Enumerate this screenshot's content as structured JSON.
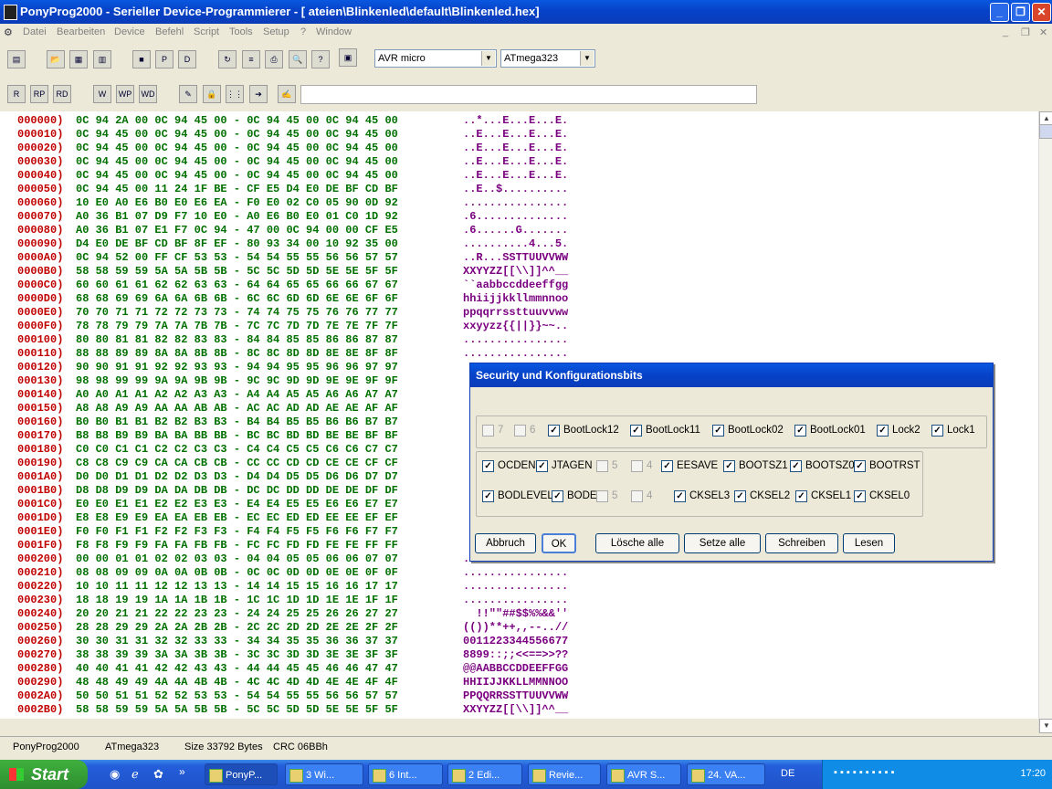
{
  "window": {
    "title": "PonyProg2000 - Serieller Device-Programmierer - [ ateien\\Blinkenled\\default\\Blinkenled.hex]",
    "minimize": "_",
    "maximize": "❐",
    "close": "✕"
  },
  "menu": [
    "Datei",
    "Bearbeiten",
    "Device",
    "Befehl",
    "Script",
    "Tools",
    "Setup",
    "?",
    "Window"
  ],
  "toolbar": {
    "device_family": "AVR micro",
    "device_model": "ATmega323",
    "status_text": ""
  },
  "hex_rows": [
    {
      "addr": "000000)",
      "hex": "0C 94 2A 00 0C 94 45 00 - 0C 94 45 00 0C 94 45 00",
      "ascii": "..*...E...E...E."
    },
    {
      "addr": "000010)",
      "hex": "0C 94 45 00 0C 94 45 00 - 0C 94 45 00 0C 94 45 00",
      "ascii": "..E...E...E...E."
    },
    {
      "addr": "000020)",
      "hex": "0C 94 45 00 0C 94 45 00 - 0C 94 45 00 0C 94 45 00",
      "ascii": "..E...E...E...E."
    },
    {
      "addr": "000030)",
      "hex": "0C 94 45 00 0C 94 45 00 - 0C 94 45 00 0C 94 45 00",
      "ascii": "..E...E...E...E."
    },
    {
      "addr": "000040)",
      "hex": "0C 94 45 00 0C 94 45 00 - 0C 94 45 00 0C 94 45 00",
      "ascii": "..E...E...E...E."
    },
    {
      "addr": "000050)",
      "hex": "0C 94 45 00 11 24 1F BE - CF E5 D4 E0 DE BF CD BF",
      "ascii": "..E..$.........."
    },
    {
      "addr": "000060)",
      "hex": "10 E0 A0 E6 B0 E0 E6 EA - F0 E0 02 C0 05 90 0D 92",
      "ascii": "................"
    },
    {
      "addr": "000070)",
      "hex": "A0 36 B1 07 D9 F7 10 E0 - A0 E6 B0 E0 01 C0 1D 92",
      "ascii": ".6.............."
    },
    {
      "addr": "000080)",
      "hex": "A0 36 B1 07 E1 F7 0C 94 - 47 00 0C 94 00 00 CF E5",
      "ascii": ".6......G......."
    },
    {
      "addr": "000090)",
      "hex": "D4 E0 DE BF CD BF 8F EF - 80 93 34 00 10 92 35 00",
      "ascii": "..........4...5."
    },
    {
      "addr": "0000A0)",
      "hex": "0C 94 52 00 FF CF 53 53 - 54 54 55 55 56 56 57 57",
      "ascii": "..R...SSTTUUVVWW"
    },
    {
      "addr": "0000B0)",
      "hex": "58 58 59 59 5A 5A 5B 5B - 5C 5C 5D 5D 5E 5E 5F 5F",
      "ascii": "XXYYZZ[[\\\\]]^^__"
    },
    {
      "addr": "0000C0)",
      "hex": "60 60 61 61 62 62 63 63 - 64 64 65 65 66 66 67 67",
      "ascii": "``aabbccddeeffgg"
    },
    {
      "addr": "0000D0)",
      "hex": "68 68 69 69 6A 6A 6B 6B - 6C 6C 6D 6D 6E 6E 6F 6F",
      "ascii": "hhiijjkkllmmnnoo"
    },
    {
      "addr": "0000E0)",
      "hex": "70 70 71 71 72 72 73 73 - 74 74 75 75 76 76 77 77",
      "ascii": "ppqqrrssttuuvvww"
    },
    {
      "addr": "0000F0)",
      "hex": "78 78 79 79 7A 7A 7B 7B - 7C 7C 7D 7D 7E 7E 7F 7F",
      "ascii": "xxyyzz{{||}}~~.."
    },
    {
      "addr": "000100)",
      "hex": "80 80 81 81 82 82 83 83 - 84 84 85 85 86 86 87 87",
      "ascii": "................"
    },
    {
      "addr": "000110)",
      "hex": "88 88 89 89 8A 8A 8B 8B - 8C 8C 8D 8D 8E 8E 8F 8F",
      "ascii": "................"
    },
    {
      "addr": "000120)",
      "hex": "90 90 91 91 92 92 93 93 - 94 94 95 95 96 96 97 97",
      "ascii": ""
    },
    {
      "addr": "000130)",
      "hex": "98 98 99 99 9A 9A 9B 9B - 9C 9C 9D 9D 9E 9E 9F 9F",
      "ascii": ""
    },
    {
      "addr": "000140)",
      "hex": "A0 A0 A1 A1 A2 A2 A3 A3 - A4 A4 A5 A5 A6 A6 A7 A7",
      "ascii": ""
    },
    {
      "addr": "000150)",
      "hex": "A8 A8 A9 A9 AA AA AB AB - AC AC AD AD AE AE AF AF",
      "ascii": ""
    },
    {
      "addr": "000160)",
      "hex": "B0 B0 B1 B1 B2 B2 B3 B3 - B4 B4 B5 B5 B6 B6 B7 B7",
      "ascii": ""
    },
    {
      "addr": "000170)",
      "hex": "B8 B8 B9 B9 BA BA BB BB - BC BC BD BD BE BE BF BF",
      "ascii": ""
    },
    {
      "addr": "000180)",
      "hex": "C0 C0 C1 C1 C2 C2 C3 C3 - C4 C4 C5 C5 C6 C6 C7 C7",
      "ascii": ""
    },
    {
      "addr": "000190)",
      "hex": "C8 C8 C9 C9 CA CA CB CB - CC CC CD CD CE CE CF CF",
      "ascii": ""
    },
    {
      "addr": "0001A0)",
      "hex": "D0 D0 D1 D1 D2 D2 D3 D3 - D4 D4 D5 D5 D6 D6 D7 D7",
      "ascii": ""
    },
    {
      "addr": "0001B0)",
      "hex": "D8 D8 D9 D9 DA DA DB DB - DC DC DD DD DE DE DF DF",
      "ascii": ""
    },
    {
      "addr": "0001C0)",
      "hex": "E0 E0 E1 E1 E2 E2 E3 E3 - E4 E4 E5 E5 E6 E6 E7 E7",
      "ascii": ""
    },
    {
      "addr": "0001D0)",
      "hex": "E8 E8 E9 E9 EA EA EB EB - EC EC ED ED EE EE EF EF",
      "ascii": ""
    },
    {
      "addr": "0001E0)",
      "hex": "F0 F0 F1 F1 F2 F2 F3 F3 - F4 F4 F5 F5 F6 F6 F7 F7",
      "ascii": ""
    },
    {
      "addr": "0001F0)",
      "hex": "F8 F8 F9 F9 FA FA FB FB - FC FC FD FD FE FE FF FF",
      "ascii": ""
    },
    {
      "addr": "000200)",
      "hex": "00 00 01 01 02 02 03 03 - 04 04 05 05 06 06 07 07",
      "ascii": "................"
    },
    {
      "addr": "000210)",
      "hex": "08 08 09 09 0A 0A 0B 0B - 0C 0C 0D 0D 0E 0E 0F 0F",
      "ascii": "................"
    },
    {
      "addr": "000220)",
      "hex": "10 10 11 11 12 12 13 13 - 14 14 15 15 16 16 17 17",
      "ascii": "................"
    },
    {
      "addr": "000230)",
      "hex": "18 18 19 19 1A 1A 1B 1B - 1C 1C 1D 1D 1E 1E 1F 1F",
      "ascii": "................"
    },
    {
      "addr": "000240)",
      "hex": "20 20 21 21 22 22 23 23 - 24 24 25 25 26 26 27 27",
      "ascii": "  !!\"\"##$$%%&&''"
    },
    {
      "addr": "000250)",
      "hex": "28 28 29 29 2A 2A 2B 2B - 2C 2C 2D 2D 2E 2E 2F 2F",
      "ascii": "(())**++,,--..//"
    },
    {
      "addr": "000260)",
      "hex": "30 30 31 31 32 32 33 33 - 34 34 35 35 36 36 37 37",
      "ascii": "0011223344556677"
    },
    {
      "addr": "000270)",
      "hex": "38 38 39 39 3A 3A 3B 3B - 3C 3C 3D 3D 3E 3E 3F 3F",
      "ascii": "8899::;;<<==>>??"
    },
    {
      "addr": "000280)",
      "hex": "40 40 41 41 42 42 43 43 - 44 44 45 45 46 46 47 47",
      "ascii": "@@AABBCCDDEEFFGG"
    },
    {
      "addr": "000290)",
      "hex": "48 48 49 49 4A 4A 4B 4B - 4C 4C 4D 4D 4E 4E 4F 4F",
      "ascii": "HHIIJJKKLLMMNNOO"
    },
    {
      "addr": "0002A0)",
      "hex": "50 50 51 51 52 52 53 53 - 54 54 55 55 56 56 57 57",
      "ascii": "PPQQRRSSTTUUVVWW"
    },
    {
      "addr": "0002B0)",
      "hex": "58 58 59 59 5A 5A 5B 5B - 5C 5C 5D 5D 5E 5E 5F 5F",
      "ascii": "XXYYZZ[[\\\\]]^^__"
    }
  ],
  "dialog": {
    "title": "Security und Konfigurationsbits",
    "lock_bits": [
      {
        "label": "7",
        "checked": false,
        "disabled": true
      },
      {
        "label": "6",
        "checked": false,
        "disabled": true
      },
      {
        "label": "BootLock12",
        "checked": true,
        "disabled": false
      },
      {
        "label": "BootLock11",
        "checked": true,
        "disabled": false
      },
      {
        "label": "BootLock02",
        "checked": true,
        "disabled": false
      },
      {
        "label": "BootLock01",
        "checked": true,
        "disabled": false
      },
      {
        "label": "Lock2",
        "checked": true,
        "disabled": false
      },
      {
        "label": "Lock1",
        "checked": true,
        "disabled": false
      }
    ],
    "fuse_high": [
      {
        "label": "OCDEN",
        "checked": true,
        "disabled": false
      },
      {
        "label": "JTAGEN",
        "checked": true,
        "disabled": false
      },
      {
        "label": "5",
        "checked": false,
        "disabled": true
      },
      {
        "label": "4",
        "checked": false,
        "disabled": true
      },
      {
        "label": "EESAVE",
        "checked": true,
        "disabled": false
      },
      {
        "label": "BOOTSZ1",
        "checked": true,
        "disabled": false
      },
      {
        "label": "BOOTSZ0",
        "checked": true,
        "disabled": false
      },
      {
        "label": "BOOTRST",
        "checked": true,
        "disabled": false
      }
    ],
    "fuse_low": [
      {
        "label": "BODLEVEL",
        "checked": true,
        "disabled": false
      },
      {
        "label": "BODEN",
        "checked": true,
        "disabled": false
      },
      {
        "label": "5",
        "checked": false,
        "disabled": true
      },
      {
        "label": "4",
        "checked": false,
        "disabled": true
      },
      {
        "label": "CKSEL3",
        "checked": true,
        "disabled": false
      },
      {
        "label": "CKSEL2",
        "checked": true,
        "disabled": false
      },
      {
        "label": "CKSEL1",
        "checked": true,
        "disabled": false
      },
      {
        "label": "CKSEL0",
        "checked": true,
        "disabled": false
      }
    ],
    "buttons": {
      "cancel": "Abbruch",
      "ok": "OK",
      "clear_all": "Lösche alle",
      "set_all": "Setze alle",
      "write": "Schreiben",
      "read": "Lesen"
    }
  },
  "statusbar": {
    "app": "PonyProg2000",
    "device": "ATmega323",
    "size": "Size 33792 Bytes",
    "crc": "CRC 06BBh"
  },
  "taskbar": {
    "start": "Start",
    "tasks": [
      "PonyP...",
      "3 Wi...",
      "6 Int...",
      "2 Edi...",
      "Revie...",
      "AVR S...",
      "24. VA..."
    ],
    "lang": "DE",
    "clock": "17:20"
  }
}
